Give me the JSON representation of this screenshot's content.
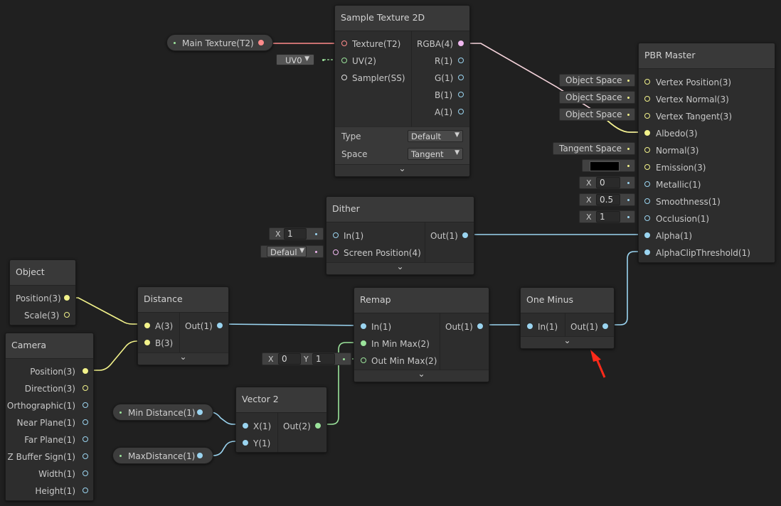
{
  "colors": {
    "vec1": "#9ad4f0",
    "vec2": "#9be39b",
    "vec3": "#f2f28a",
    "vec4": "#f0b8f0",
    "texture": "#ff8b8b",
    "albedo_wire": "#f2f28a"
  },
  "properties": {
    "main_texture": "Main Texture(T2)",
    "min_distance": "Min Distance(1)",
    "max_distance": "MaxDistance(1)"
  },
  "sample_texture": {
    "title": "Sample Texture 2D",
    "inputs": [
      "Texture(T2)",
      "UV(2)",
      "Sampler(SS)"
    ],
    "outputs": [
      "RGBA(4)",
      "R(1)",
      "G(1)",
      "B(1)",
      "A(1)"
    ],
    "uv_dropdown": "UV0",
    "type_label": "Type",
    "type_value": "Default",
    "space_label": "Space",
    "space_value": "Tangent"
  },
  "pbr_master": {
    "title": "PBR Master",
    "inputs": [
      "Vertex Position(3)",
      "Vertex Normal(3)",
      "Vertex Tangent(3)",
      "Albedo(3)",
      "Normal(3)",
      "Emission(3)",
      "Metallic(1)",
      "Smoothness(1)",
      "Occlusion(1)",
      "Alpha(1)",
      "AlphaClipThreshold(1)"
    ],
    "object_space": "Object Space",
    "tangent_space": "Tangent Space",
    "emission_color": "#000000",
    "metallic": "0",
    "smoothness": "0.5",
    "occlusion": "1",
    "x_label": "X"
  },
  "dither": {
    "title": "Dither",
    "inputs": [
      "In(1)",
      "Screen Position(4)"
    ],
    "output": "Out(1)",
    "in_value": "1",
    "x_label": "X",
    "screen_dropdown": "Defaul"
  },
  "object": {
    "title": "Object",
    "outputs": [
      "Position(3)",
      "Scale(3)"
    ]
  },
  "camera": {
    "title": "Camera",
    "outputs": [
      "Position(3)",
      "Direction(3)",
      "Orthographic(1)",
      "Near Plane(1)",
      "Far Plane(1)",
      "Z Buffer Sign(1)",
      "Width(1)",
      "Height(1)"
    ]
  },
  "distance": {
    "title": "Distance",
    "inputs": [
      "A(3)",
      "B(3)"
    ],
    "output": "Out(1)"
  },
  "remap": {
    "title": "Remap",
    "inputs": [
      "In(1)",
      "In Min Max(2)",
      "Out Min Max(2)"
    ],
    "output": "Out(1)",
    "out_x": "0",
    "out_y": "1",
    "x_label": "X",
    "y_label": "Y"
  },
  "one_minus": {
    "title": "One Minus",
    "input": "In(1)",
    "output": "Out(1)"
  },
  "vector2": {
    "title": "Vector 2",
    "inputs": [
      "X(1)",
      "Y(1)"
    ],
    "output": "Out(2)"
  },
  "icons": {
    "chevron": "chevron-down-icon",
    "dropdown": "dropdown-arrow-icon",
    "annotation": "red-arrow-icon"
  },
  "glyphs": {
    "chevron": "⌄",
    "dropdown": "▼"
  }
}
